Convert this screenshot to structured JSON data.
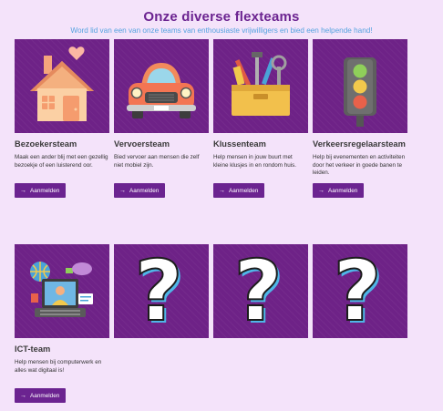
{
  "header": {
    "title": "Onze diverse flexteams",
    "subtitle": "Word lid van een van onze teams van enthousiaste vrijwilligers en bied een helpende hand!"
  },
  "teams": [
    {
      "name": "Bezoekersteam",
      "description": "Maak een ander blij met een gezellig bezoekje of een luisterend oor.",
      "button": "Aanmelden",
      "icon": "house-heart-icon"
    },
    {
      "name": "Vervoersteam",
      "description": "Bied vervoer aan mensen die zelf niet mobiel zijn.",
      "button": "Aanmelden",
      "icon": "car-icon"
    },
    {
      "name": "Klussenteam",
      "description": "Help mensen in jouw buurt met kleine klusjes in en rondom huis.",
      "button": "Aanmelden",
      "icon": "toolbox-icon"
    },
    {
      "name": "Verkeersregelaarsteam",
      "description": "Help bij evenementen en activiteiten door het verkeer in goede banen te leiden.",
      "button": "Aanmelden",
      "icon": "traffic-light-icon"
    },
    {
      "name": "ICT-team",
      "description": "Help mensen bij computerwerk en alles wat digitaal is!",
      "button": "Aanmelden",
      "icon": "laptop-user-icon"
    }
  ],
  "placeholders": [
    {
      "icon": "question-mark-icon"
    },
    {
      "icon": "question-mark-icon"
    },
    {
      "icon": "question-mark-icon"
    }
  ],
  "colors": {
    "accent": "#6b2390",
    "tile": "#6e2287",
    "background": "#f4e3fa",
    "subtitle": "#55a3e0"
  }
}
